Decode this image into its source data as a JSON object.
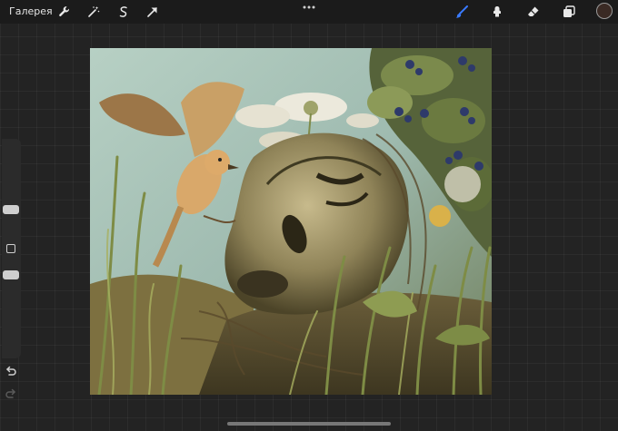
{
  "topbar": {
    "gallery_label": "Галерея",
    "left_tools": [
      "wrench-icon",
      "magic-wand-icon",
      "selection-icon",
      "transform-arrow-icon"
    ],
    "right_tools": [
      "brush-icon",
      "smudge-icon",
      "eraser-icon",
      "layers-icon"
    ],
    "active_tool": "brush-icon",
    "accent_color": "#3a7bff",
    "current_color": "#3a2a24"
  },
  "sidebar": {
    "controls": [
      "brush-size-slider",
      "modify-button",
      "opacity-slider",
      "undo-icon",
      "redo-icon"
    ]
  },
  "canvas": {
    "artwork": "painting-bird-and-face-in-grass"
  }
}
